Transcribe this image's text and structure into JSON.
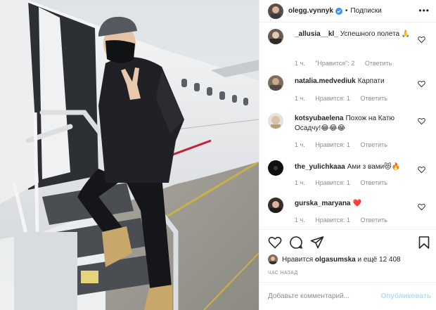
{
  "post": {
    "username": "olegg.vynnyk",
    "separator": "•",
    "follow_label": "Подписки",
    "more_icon": "more-horizontal-icon"
  },
  "comments": [
    {
      "user": "_allusia__kl_",
      "text": "Успешного полета 🙏",
      "time": "1 ч.",
      "likes": "\"Нравится\": 2",
      "reply": "Ответить"
    },
    {
      "user": "natalia.medvediuk",
      "text": "Карпати",
      "time": "1 ч.",
      "likes": "Нравится: 1",
      "reply": "Ответить"
    },
    {
      "user": "kotsyubaelena",
      "text": "Похож на Катю Осадчу!😂😂😂",
      "time": "1 ч.",
      "likes": "Нравится: 1",
      "reply": "Ответить"
    },
    {
      "user": "the_yulichkaaa",
      "text": "Ами з вами😻🔥",
      "time": "1 ч.",
      "likes": "Нравится: 1",
      "reply": "Ответить"
    },
    {
      "user": "gurska_maryana",
      "text": "❤️",
      "time": "1 ч.",
      "likes": "Нравится: 1",
      "reply": "Ответить"
    }
  ],
  "likes": {
    "prefix": "Нравится",
    "user": "olgasumska",
    "suffix": "и ещё 12 408"
  },
  "time_ago": "ЧАС НАЗАД",
  "add_comment": {
    "placeholder": "Добавьте комментарий...",
    "submit_label": "Опубликовать"
  },
  "colors": {
    "verified": "#3897f0",
    "muted": "#8e8e8e",
    "publish_disabled": "#b3dbff",
    "heart_red": "#ed4956"
  }
}
